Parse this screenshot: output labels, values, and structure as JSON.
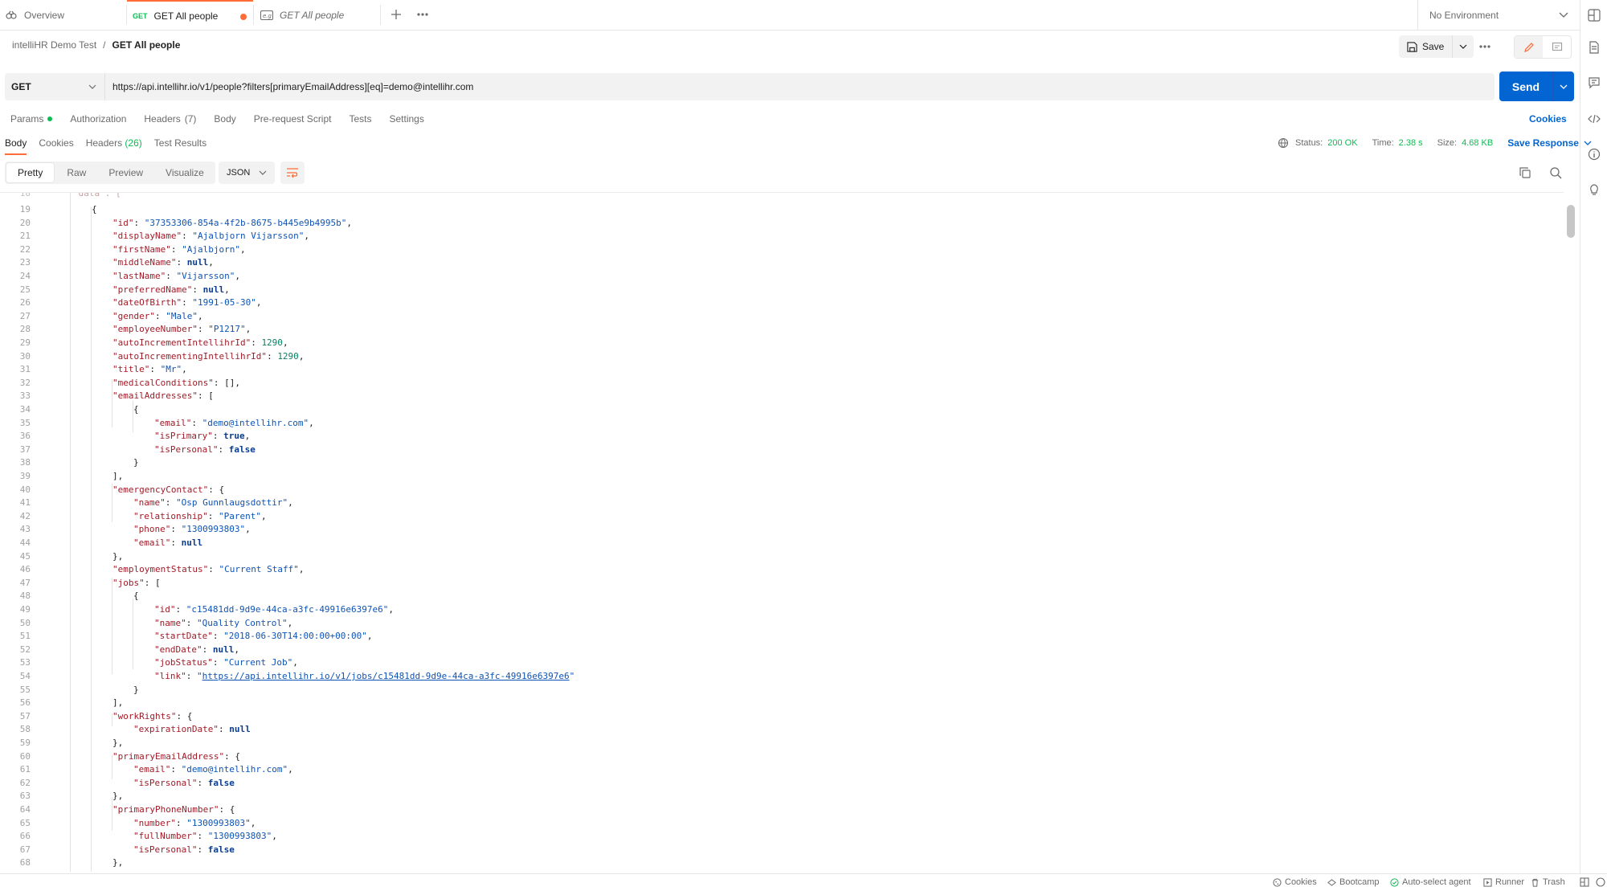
{
  "tabs": [
    {
      "label": "Overview",
      "method": ""
    },
    {
      "label": "GET All people",
      "method": "GET"
    },
    {
      "label": "GET All people",
      "method": ""
    }
  ],
  "environment": "No Environment",
  "breadcrumb": {
    "parent": "intelliHR Demo Test",
    "separator": "/",
    "current": "GET All people"
  },
  "request": {
    "save_label": "Save",
    "method": "GET",
    "url": "https://api.intellihr.io/v1/people?filters[primaryEmailAddress][eq]=demo@intellihr.com",
    "send_label": "Send"
  },
  "request_tabs": [
    {
      "label": "Params",
      "count": ""
    },
    {
      "label": "Authorization",
      "count": ""
    },
    {
      "label": "Headers",
      "count": "(7)"
    },
    {
      "label": "Body",
      "count": ""
    },
    {
      "label": "Pre-request Script",
      "count": ""
    },
    {
      "label": "Tests",
      "count": ""
    },
    {
      "label": "Settings",
      "count": ""
    }
  ],
  "cookies_link": "Cookies",
  "response_tabs": [
    {
      "label": "Body",
      "count": ""
    },
    {
      "label": "Cookies",
      "count": ""
    },
    {
      "label": "Headers",
      "count": "(26)"
    },
    {
      "label": "Test Results",
      "count": ""
    }
  ],
  "response_meta": {
    "status_label": "Status:",
    "status": "200 OK",
    "time_label": "Time:",
    "time": "2.38 s",
    "size_label": "Size:",
    "size": "4.68 KB",
    "save_response": "Save Response"
  },
  "viewer": {
    "modes": [
      "Pretty",
      "Raw",
      "Preview",
      "Visualize"
    ],
    "format": "JSON"
  },
  "code_lines": [
    {
      "n": "19",
      "i": 1,
      "t": [
        {
          "c": "p",
          "v": "{"
        }
      ]
    },
    {
      "n": "20",
      "i": 2,
      "t": [
        {
          "c": "k",
          "v": "\"id\""
        },
        {
          "c": "p",
          "v": ": "
        },
        {
          "c": "s",
          "v": "\"37353306-854a-4f2b-8675-b445e9b4995b\""
        },
        {
          "c": "p",
          "v": ","
        }
      ]
    },
    {
      "n": "21",
      "i": 2,
      "t": [
        {
          "c": "k",
          "v": "\"displayName\""
        },
        {
          "c": "p",
          "v": ": "
        },
        {
          "c": "s",
          "v": "\"Ajalbjorn Vijarsson\""
        },
        {
          "c": "p",
          "v": ","
        }
      ]
    },
    {
      "n": "22",
      "i": 2,
      "t": [
        {
          "c": "k",
          "v": "\"firstName\""
        },
        {
          "c": "p",
          "v": ": "
        },
        {
          "c": "s",
          "v": "\"Ajalbjorn\""
        },
        {
          "c": "p",
          "v": ","
        }
      ]
    },
    {
      "n": "23",
      "i": 2,
      "t": [
        {
          "c": "k",
          "v": "\"middleName\""
        },
        {
          "c": "p",
          "v": ": "
        },
        {
          "c": "b",
          "v": "null"
        },
        {
          "c": "p",
          "v": ","
        }
      ]
    },
    {
      "n": "24",
      "i": 2,
      "t": [
        {
          "c": "k",
          "v": "\"lastName\""
        },
        {
          "c": "p",
          "v": ": "
        },
        {
          "c": "s",
          "v": "\"Vijarsson\""
        },
        {
          "c": "p",
          "v": ","
        }
      ]
    },
    {
      "n": "25",
      "i": 2,
      "t": [
        {
          "c": "k",
          "v": "\"preferredName\""
        },
        {
          "c": "p",
          "v": ": "
        },
        {
          "c": "b",
          "v": "null"
        },
        {
          "c": "p",
          "v": ","
        }
      ]
    },
    {
      "n": "26",
      "i": 2,
      "t": [
        {
          "c": "k",
          "v": "\"dateOfBirth\""
        },
        {
          "c": "p",
          "v": ": "
        },
        {
          "c": "s",
          "v": "\"1991-05-30\""
        },
        {
          "c": "p",
          "v": ","
        }
      ]
    },
    {
      "n": "27",
      "i": 2,
      "t": [
        {
          "c": "k",
          "v": "\"gender\""
        },
        {
          "c": "p",
          "v": ": "
        },
        {
          "c": "s",
          "v": "\"Male\""
        },
        {
          "c": "p",
          "v": ","
        }
      ]
    },
    {
      "n": "28",
      "i": 2,
      "t": [
        {
          "c": "k",
          "v": "\"employeeNumber\""
        },
        {
          "c": "p",
          "v": ": "
        },
        {
          "c": "s",
          "v": "\"P1217\""
        },
        {
          "c": "p",
          "v": ","
        }
      ]
    },
    {
      "n": "29",
      "i": 2,
      "t": [
        {
          "c": "k",
          "v": "\"autoIncrementIntellihrId\""
        },
        {
          "c": "p",
          "v": ": "
        },
        {
          "c": "n",
          "v": "1290"
        },
        {
          "c": "p",
          "v": ","
        }
      ]
    },
    {
      "n": "30",
      "i": 2,
      "t": [
        {
          "c": "k",
          "v": "\"autoIncrementingIntellihrId\""
        },
        {
          "c": "p",
          "v": ": "
        },
        {
          "c": "n",
          "v": "1290"
        },
        {
          "c": "p",
          "v": ","
        }
      ]
    },
    {
      "n": "31",
      "i": 2,
      "t": [
        {
          "c": "k",
          "v": "\"title\""
        },
        {
          "c": "p",
          "v": ": "
        },
        {
          "c": "s",
          "v": "\"Mr\""
        },
        {
          "c": "p",
          "v": ","
        }
      ]
    },
    {
      "n": "32",
      "i": 2,
      "t": [
        {
          "c": "k",
          "v": "\"medicalConditions\""
        },
        {
          "c": "p",
          "v": ": [],"
        }
      ]
    },
    {
      "n": "33",
      "i": 2,
      "t": [
        {
          "c": "k",
          "v": "\"emailAddresses\""
        },
        {
          "c": "p",
          "v": ": ["
        }
      ]
    },
    {
      "n": "34",
      "i": 3,
      "t": [
        {
          "c": "p",
          "v": "{"
        }
      ]
    },
    {
      "n": "35",
      "i": 4,
      "t": [
        {
          "c": "k",
          "v": "\"email\""
        },
        {
          "c": "p",
          "v": ": "
        },
        {
          "c": "s",
          "v": "\"demo@intellihr.com\""
        },
        {
          "c": "p",
          "v": ","
        }
      ]
    },
    {
      "n": "36",
      "i": 4,
      "t": [
        {
          "c": "k",
          "v": "\"isPrimary\""
        },
        {
          "c": "p",
          "v": ": "
        },
        {
          "c": "b",
          "v": "true"
        },
        {
          "c": "p",
          "v": ","
        }
      ]
    },
    {
      "n": "37",
      "i": 4,
      "t": [
        {
          "c": "k",
          "v": "\"isPersonal\""
        },
        {
          "c": "p",
          "v": ": "
        },
        {
          "c": "b",
          "v": "false"
        }
      ]
    },
    {
      "n": "38",
      "i": 3,
      "t": [
        {
          "c": "p",
          "v": "}"
        }
      ]
    },
    {
      "n": "39",
      "i": 2,
      "t": [
        {
          "c": "p",
          "v": "],"
        }
      ]
    },
    {
      "n": "40",
      "i": 2,
      "t": [
        {
          "c": "k",
          "v": "\"emergencyContact\""
        },
        {
          "c": "p",
          "v": ": {"
        }
      ]
    },
    {
      "n": "41",
      "i": 3,
      "t": [
        {
          "c": "k",
          "v": "\"name\""
        },
        {
          "c": "p",
          "v": ": "
        },
        {
          "c": "s",
          "v": "\"Osp Gunnlaugsdottir\""
        },
        {
          "c": "p",
          "v": ","
        }
      ]
    },
    {
      "n": "42",
      "i": 3,
      "t": [
        {
          "c": "k",
          "v": "\"relationship\""
        },
        {
          "c": "p",
          "v": ": "
        },
        {
          "c": "s",
          "v": "\"Parent\""
        },
        {
          "c": "p",
          "v": ","
        }
      ]
    },
    {
      "n": "43",
      "i": 3,
      "t": [
        {
          "c": "k",
          "v": "\"phone\""
        },
        {
          "c": "p",
          "v": ": "
        },
        {
          "c": "s",
          "v": "\"1300993803\""
        },
        {
          "c": "p",
          "v": ","
        }
      ]
    },
    {
      "n": "44",
      "i": 3,
      "t": [
        {
          "c": "k",
          "v": "\"email\""
        },
        {
          "c": "p",
          "v": ": "
        },
        {
          "c": "b",
          "v": "null"
        }
      ]
    },
    {
      "n": "45",
      "i": 2,
      "t": [
        {
          "c": "p",
          "v": "},"
        }
      ]
    },
    {
      "n": "46",
      "i": 2,
      "t": [
        {
          "c": "k",
          "v": "\"employmentStatus\""
        },
        {
          "c": "p",
          "v": ": "
        },
        {
          "c": "s",
          "v": "\"Current Staff\""
        },
        {
          "c": "p",
          "v": ","
        }
      ]
    },
    {
      "n": "47",
      "i": 2,
      "t": [
        {
          "c": "k",
          "v": "\"jobs\""
        },
        {
          "c": "p",
          "v": ": ["
        }
      ]
    },
    {
      "n": "48",
      "i": 3,
      "t": [
        {
          "c": "p",
          "v": "{"
        }
      ]
    },
    {
      "n": "49",
      "i": 4,
      "t": [
        {
          "c": "k",
          "v": "\"id\""
        },
        {
          "c": "p",
          "v": ": "
        },
        {
          "c": "s",
          "v": "\"c15481dd-9d9e-44ca-a3fc-49916e6397e6\""
        },
        {
          "c": "p",
          "v": ","
        }
      ]
    },
    {
      "n": "50",
      "i": 4,
      "t": [
        {
          "c": "k",
          "v": "\"name\""
        },
        {
          "c": "p",
          "v": ": "
        },
        {
          "c": "s",
          "v": "\"Quality Control\""
        },
        {
          "c": "p",
          "v": ","
        }
      ]
    },
    {
      "n": "51",
      "i": 4,
      "t": [
        {
          "c": "k",
          "v": "\"startDate\""
        },
        {
          "c": "p",
          "v": ": "
        },
        {
          "c": "s",
          "v": "\"2018-06-30T14:00:00+00:00\""
        },
        {
          "c": "p",
          "v": ","
        }
      ]
    },
    {
      "n": "52",
      "i": 4,
      "t": [
        {
          "c": "k",
          "v": "\"endDate\""
        },
        {
          "c": "p",
          "v": ": "
        },
        {
          "c": "b",
          "v": "null"
        },
        {
          "c": "p",
          "v": ","
        }
      ]
    },
    {
      "n": "53",
      "i": 4,
      "t": [
        {
          "c": "k",
          "v": "\"jobStatus\""
        },
        {
          "c": "p",
          "v": ": "
        },
        {
          "c": "s",
          "v": "\"Current Job\""
        },
        {
          "c": "p",
          "v": ","
        }
      ]
    },
    {
      "n": "54",
      "i": 4,
      "t": [
        {
          "c": "k",
          "v": "\"link\""
        },
        {
          "c": "p",
          "v": ": "
        },
        {
          "c": "s",
          "v": "\""
        },
        {
          "c": "u",
          "v": "https://api.intellihr.io/v1/jobs/c15481dd-9d9e-44ca-a3fc-49916e6397e6"
        },
        {
          "c": "s",
          "v": "\""
        }
      ]
    },
    {
      "n": "55",
      "i": 3,
      "t": [
        {
          "c": "p",
          "v": "}"
        }
      ]
    },
    {
      "n": "56",
      "i": 2,
      "t": [
        {
          "c": "p",
          "v": "],"
        }
      ]
    },
    {
      "n": "57",
      "i": 2,
      "t": [
        {
          "c": "k",
          "v": "\"workRights\""
        },
        {
          "c": "p",
          "v": ": {"
        }
      ]
    },
    {
      "n": "58",
      "i": 3,
      "t": [
        {
          "c": "k",
          "v": "\"expirationDate\""
        },
        {
          "c": "p",
          "v": ": "
        },
        {
          "c": "b",
          "v": "null"
        }
      ]
    },
    {
      "n": "59",
      "i": 2,
      "t": [
        {
          "c": "p",
          "v": "},"
        }
      ]
    },
    {
      "n": "60",
      "i": 2,
      "t": [
        {
          "c": "k",
          "v": "\"primaryEmailAddress\""
        },
        {
          "c": "p",
          "v": ": {"
        }
      ]
    },
    {
      "n": "61",
      "i": 3,
      "t": [
        {
          "c": "k",
          "v": "\"email\""
        },
        {
          "c": "p",
          "v": ": "
        },
        {
          "c": "s",
          "v": "\"demo@intellihr.com\""
        },
        {
          "c": "p",
          "v": ","
        }
      ]
    },
    {
      "n": "62",
      "i": 3,
      "t": [
        {
          "c": "k",
          "v": "\"isPersonal\""
        },
        {
          "c": "p",
          "v": ": "
        },
        {
          "c": "b",
          "v": "false"
        }
      ]
    },
    {
      "n": "63",
      "i": 2,
      "t": [
        {
          "c": "p",
          "v": "},"
        }
      ]
    },
    {
      "n": "64",
      "i": 2,
      "t": [
        {
          "c": "k",
          "v": "\"primaryPhoneNumber\""
        },
        {
          "c": "p",
          "v": ": {"
        }
      ]
    },
    {
      "n": "65",
      "i": 3,
      "t": [
        {
          "c": "k",
          "v": "\"number\""
        },
        {
          "c": "p",
          "v": ": "
        },
        {
          "c": "s",
          "v": "\"1300993803\""
        },
        {
          "c": "p",
          "v": ","
        }
      ]
    },
    {
      "n": "66",
      "i": 3,
      "t": [
        {
          "c": "k",
          "v": "\"fullNumber\""
        },
        {
          "c": "p",
          "v": ": "
        },
        {
          "c": "s",
          "v": "\"1300993803\""
        },
        {
          "c": "p",
          "v": ","
        }
      ]
    },
    {
      "n": "67",
      "i": 3,
      "t": [
        {
          "c": "k",
          "v": "\"isPersonal\""
        },
        {
          "c": "p",
          "v": ": "
        },
        {
          "c": "b",
          "v": "false"
        }
      ]
    },
    {
      "n": "68",
      "i": 2,
      "t": [
        {
          "c": "p",
          "v": "},"
        }
      ]
    }
  ],
  "statusbar": [
    "Cookies",
    "Bootcamp",
    "Auto-select agent",
    "Runner",
    "Trash"
  ],
  "colors": {
    "accent": "#ff6c37",
    "send": "#0265d2",
    "success": "#0cbb52"
  }
}
